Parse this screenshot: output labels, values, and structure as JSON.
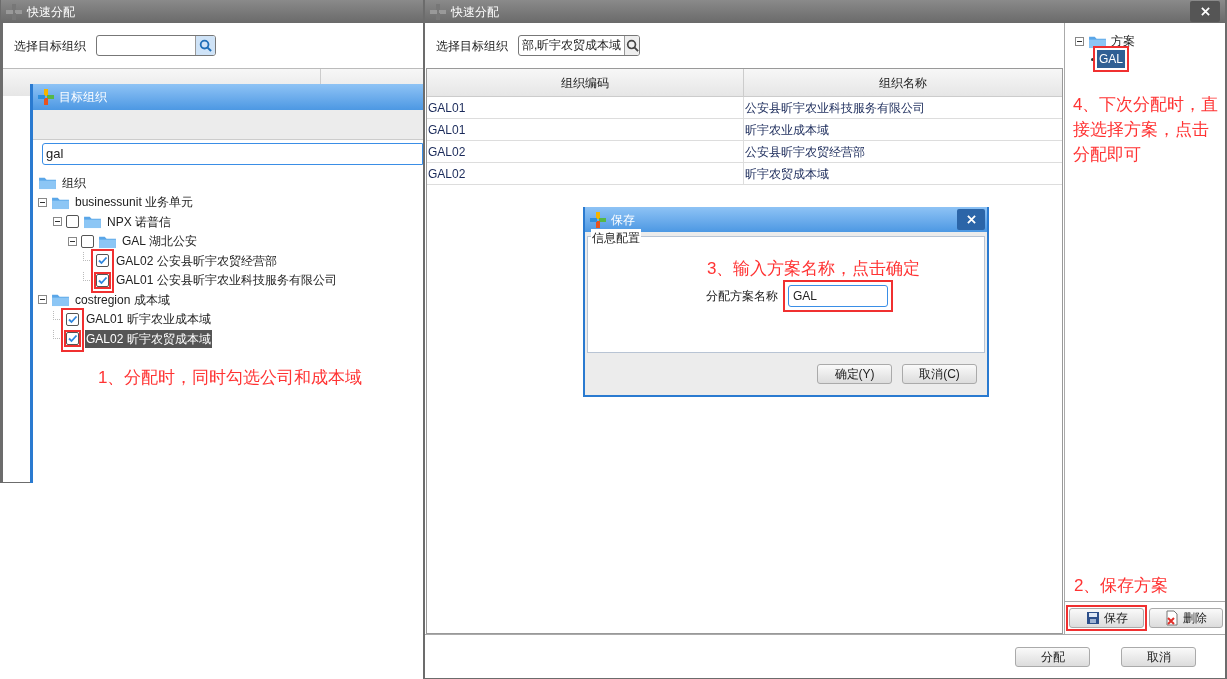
{
  "left_window": {
    "title": "快速分配",
    "search_label": "选择目标组织"
  },
  "target_dialog": {
    "title": "目标组织",
    "search_value": "gal",
    "tree": [
      {
        "label": "组织",
        "selected": false,
        "children": [
          {
            "label": "businessunit 业务单元",
            "expanded": true,
            "selected": false,
            "children": [
              {
                "label": "NPX 诺普信",
                "expanded": true,
                "checked": false,
                "selected": false,
                "children": [
                  {
                    "label": "GAL 湖北公安",
                    "expanded": true,
                    "checked": false,
                    "selected": false,
                    "children": [
                      {
                        "label": "GAL02 公安县昕宇农贸经营部",
                        "checked": true,
                        "selected": false
                      },
                      {
                        "label": "GAL01 公安县昕宇农业科技服务有限公司",
                        "checked": true,
                        "selected": false
                      }
                    ]
                  }
                ]
              }
            ]
          },
          {
            "label": "costregion 成本域",
            "expanded": true,
            "selected": false,
            "children": [
              {
                "label": "GAL01 昕宇农业成本域",
                "checked": true,
                "selected": false
              },
              {
                "label": "GAL02 昕宇农贸成本域",
                "checked": true,
                "selected": true
              }
            ]
          }
        ]
      }
    ]
  },
  "right_window": {
    "title": "快速分配",
    "search_label": "选择目标组织",
    "search_value": "部,昕宇农贸成本域",
    "table": {
      "columns": [
        "组织编码",
        "组织名称"
      ],
      "rows": [
        [
          "GAL01",
          "公安县昕宇农业科技服务有限公司"
        ],
        [
          "GAL01",
          "昕宇农业成本域"
        ],
        [
          "GAL02",
          "公安县昕宇农贸经营部"
        ],
        [
          "GAL02",
          "昕宇农贸成本域"
        ]
      ]
    },
    "scheme_tree": {
      "label": "方案",
      "expanded": true,
      "children": [
        {
          "label": "GAL",
          "selected": true
        }
      ]
    },
    "panel_buttons": [
      "保存",
      "删除"
    ],
    "footer_buttons": [
      "分配",
      "取消"
    ]
  },
  "save_dialog": {
    "title": "保存",
    "group_title": "信息配置",
    "field_label": "分配方案名称",
    "field_value": "GAL",
    "buttons": [
      "确定(Y)",
      "取消(C)"
    ]
  },
  "annotations": [
    "1、分配时，同时勾选公司和成本域",
    "2、保存方案",
    "3、输入方案名称，点击确定",
    "4、下次分配时，直接选择方案，点击分配即可"
  ]
}
